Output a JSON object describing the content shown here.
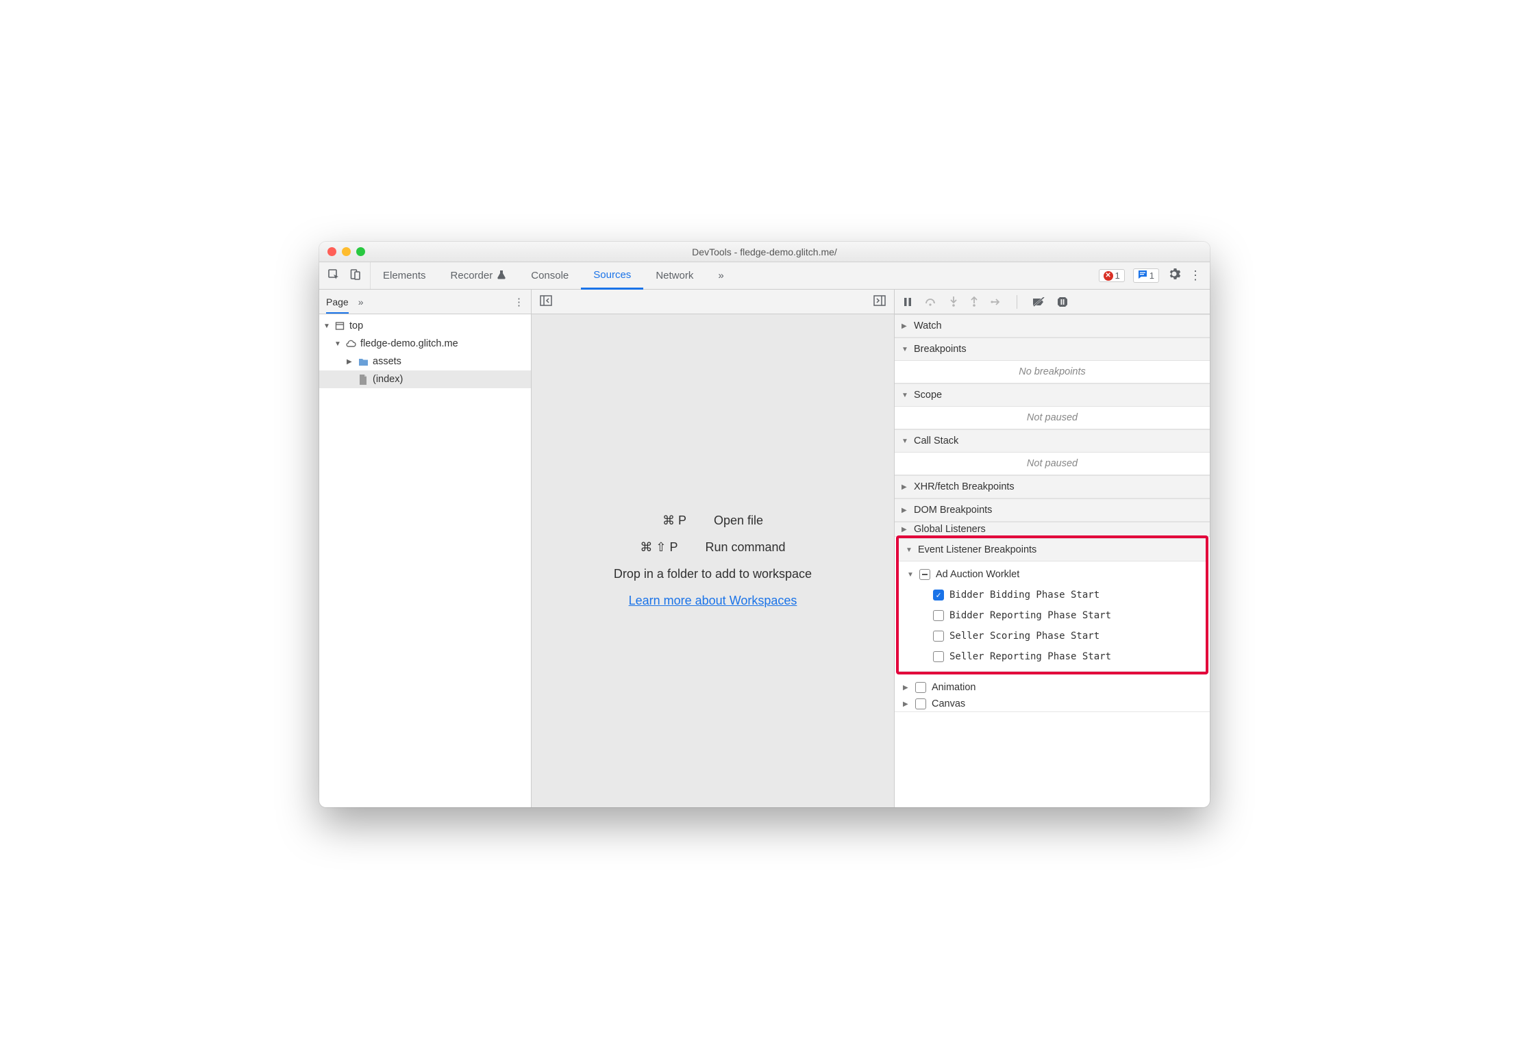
{
  "window": {
    "title": "DevTools - fledge-demo.glitch.me/"
  },
  "tabs": {
    "items": [
      "Elements",
      "Recorder",
      "Console",
      "Sources",
      "Network"
    ],
    "active_index": 3,
    "error_count": "1",
    "message_count": "1"
  },
  "page_panel": {
    "tab_label": "Page",
    "tree": {
      "top": "top",
      "origin": "fledge-demo.glitch.me",
      "folder": "assets",
      "index": "(index)"
    }
  },
  "center": {
    "open_file_keys": "⌘ P",
    "open_file_label": "Open file",
    "run_cmd_keys": "⌘ ⇧ P",
    "run_cmd_label": "Run command",
    "drop_hint": "Drop in a folder to add to workspace",
    "learn_link": "Learn more about Workspaces"
  },
  "right": {
    "sections": {
      "watch": "Watch",
      "breakpoints": "Breakpoints",
      "breakpoints_empty": "No breakpoints",
      "scope": "Scope",
      "scope_empty": "Not paused",
      "callstack": "Call Stack",
      "callstack_empty": "Not paused",
      "xhr": "XHR/fetch Breakpoints",
      "dom": "DOM Breakpoints",
      "global": "Global Listeners",
      "event_listener": "Event Listener Breakpoints",
      "animation": "Animation",
      "canvas": "Canvas"
    },
    "ad_auction": {
      "group": "Ad Auction Worklet",
      "items": [
        {
          "label": "Bidder Bidding Phase Start",
          "checked": true
        },
        {
          "label": "Bidder Reporting Phase Start",
          "checked": false
        },
        {
          "label": "Seller Scoring Phase Start",
          "checked": false
        },
        {
          "label": "Seller Reporting Phase Start",
          "checked": false
        }
      ]
    }
  }
}
